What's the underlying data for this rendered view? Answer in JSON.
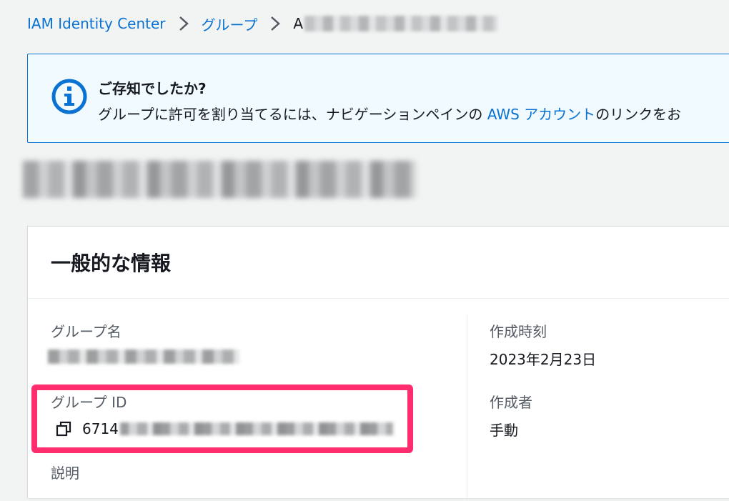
{
  "breadcrumb": {
    "items": [
      "IAM Identity Center",
      "グループ"
    ],
    "current_visible": "A"
  },
  "info": {
    "title": "ご存知でしたか?",
    "body_prefix": "グループに許可を割り当てるには、ナビゲーションペインの ",
    "link": "AWS アカウント",
    "body_suffix": "のリンクをお"
  },
  "section": {
    "title": "一般的な情報",
    "fields": {
      "group_name_label": "グループ名",
      "group_id_label": "グループ ID",
      "group_id_value_visible": "6714",
      "description_label": "説明",
      "created_time_label": "作成時刻",
      "created_time_value": "2023年2月23日",
      "created_by_label": "作成者",
      "created_by_value": "手動"
    }
  },
  "colors": {
    "link": "#0972d3",
    "info_bg": "#f1faff",
    "highlight": "#ff2d6e"
  },
  "icons": [
    "chevron-right-icon",
    "info-icon",
    "copy-icon"
  ]
}
